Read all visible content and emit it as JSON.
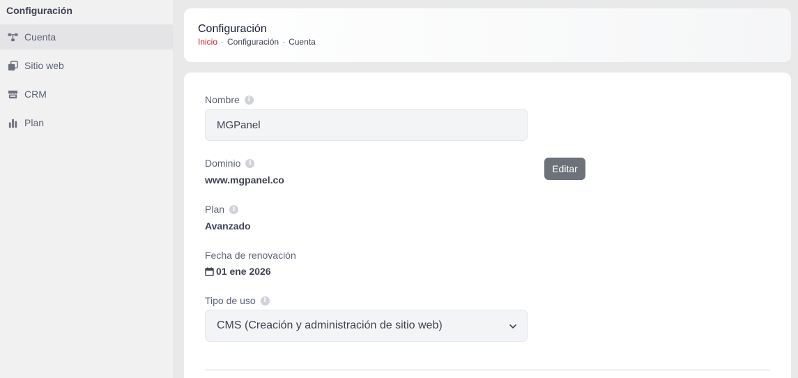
{
  "sidebar": {
    "title": "Configuración",
    "items": [
      {
        "label": "Cuenta",
        "icon": "sitemap-icon",
        "active": true
      },
      {
        "label": "Sitio web",
        "icon": "clone-icon",
        "active": false
      },
      {
        "label": "CRM",
        "icon": "store-icon",
        "active": false
      },
      {
        "label": "Plan",
        "icon": "chart-bar-icon",
        "active": false
      }
    ]
  },
  "header": {
    "title": "Configuración",
    "breadcrumb": [
      "Inicio",
      "Configuración",
      "Cuenta"
    ],
    "separator": "-"
  },
  "form": {
    "nombre": {
      "label": "Nombre",
      "value": "MGPanel",
      "info_icon": "i"
    },
    "dominio": {
      "label": "Dominio",
      "value": "www.mgpanel.co",
      "info_icon": "i",
      "edit_label": "Editar"
    },
    "plan": {
      "label": "Plan",
      "value": "Avanzado",
      "info_icon": "i"
    },
    "renovacion": {
      "label": "Fecha de renovación",
      "value": "01 ene 2026"
    },
    "tipo_uso": {
      "label": "Tipo de uso",
      "value": "CMS (Creación y administración de sitio web)",
      "info_icon": "i"
    }
  },
  "colors": {
    "accent_home_link": "#c1272d",
    "button_bg": "#6d7179",
    "sidebar_bg": "#f1f1f2",
    "page_bg": "#e9e9e9"
  }
}
